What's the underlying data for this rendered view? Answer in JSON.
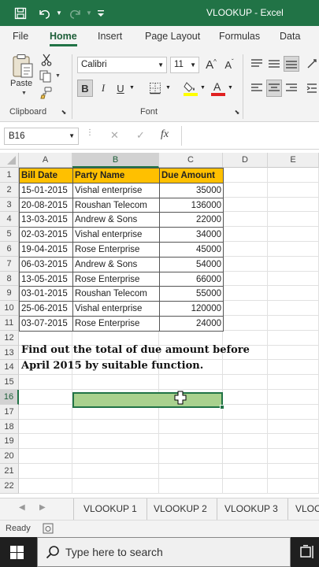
{
  "titlebar": {
    "title": "VLOOKUP - Excel",
    "background": "#217346"
  },
  "ribbon_tabs": [
    {
      "label": "File",
      "active": false
    },
    {
      "label": "Home",
      "active": true
    },
    {
      "label": "Insert",
      "active": false
    },
    {
      "label": "Page Layout",
      "active": false
    },
    {
      "label": "Formulas",
      "active": false
    },
    {
      "label": "Data",
      "active": false
    }
  ],
  "ribbon": {
    "clipboard": {
      "paste_label": "Paste",
      "group_label": "Clipboard"
    },
    "font": {
      "font_name": "Calibri",
      "font_size": "11",
      "increase_size": "A",
      "decrease_size": "A",
      "bold": "B",
      "italic": "I",
      "underline": "U",
      "group_label": "Font"
    }
  },
  "formula_bar": {
    "name_box": "B16",
    "cancel_icon": "✕",
    "enter_icon": "✓",
    "fx": "fx",
    "content": ""
  },
  "grid": {
    "columns": [
      "A",
      "B",
      "C",
      "D",
      "E"
    ],
    "rows": [
      "1",
      "2",
      "3",
      "4",
      "5",
      "6",
      "7",
      "8",
      "9",
      "10",
      "11",
      "12",
      "13",
      "14",
      "15",
      "16",
      "17",
      "18",
      "19",
      "20",
      "21",
      "22"
    ],
    "selected_column": "B",
    "selected_row": "16",
    "selected_cell": "B16",
    "selection_fill": "#a9d18e",
    "header_fill": "#ffc000"
  },
  "table": {
    "headers": [
      "Bill Date",
      "Party Name",
      "Due Amount"
    ],
    "rows": [
      [
        "15-01-2015",
        "Vishal enterprise",
        "35000"
      ],
      [
        "20-08-2015",
        "Roushan Telecom",
        "136000"
      ],
      [
        "13-03-2015",
        "Andrew & Sons",
        "22000"
      ],
      [
        "02-03-2015",
        "Vishal enterprise",
        "34000"
      ],
      [
        "19-04-2015",
        "Rose Enterprise",
        "45000"
      ],
      [
        "06-03-2015",
        "Andrew & Sons",
        "54000"
      ],
      [
        "13-05-2015",
        "Rose Enterprise",
        "66000"
      ],
      [
        "03-01-2015",
        "Roushan Telecom",
        "55000"
      ],
      [
        "25-06-2015",
        "Vishal enterprise",
        "120000"
      ],
      [
        "03-07-2015",
        "Rose Enterprise",
        "24000"
      ]
    ]
  },
  "note": {
    "line1": "Find out the total of due amount before",
    "line2": "April 2015 by suitable function."
  },
  "sheet_tabs": [
    "VLOOKUP 1",
    "VLOOKUP 2",
    "VLOOKUP 3",
    "VLOO"
  ],
  "status": {
    "ready": "Ready"
  },
  "taskbar": {
    "search_placeholder": "Type here to search"
  }
}
